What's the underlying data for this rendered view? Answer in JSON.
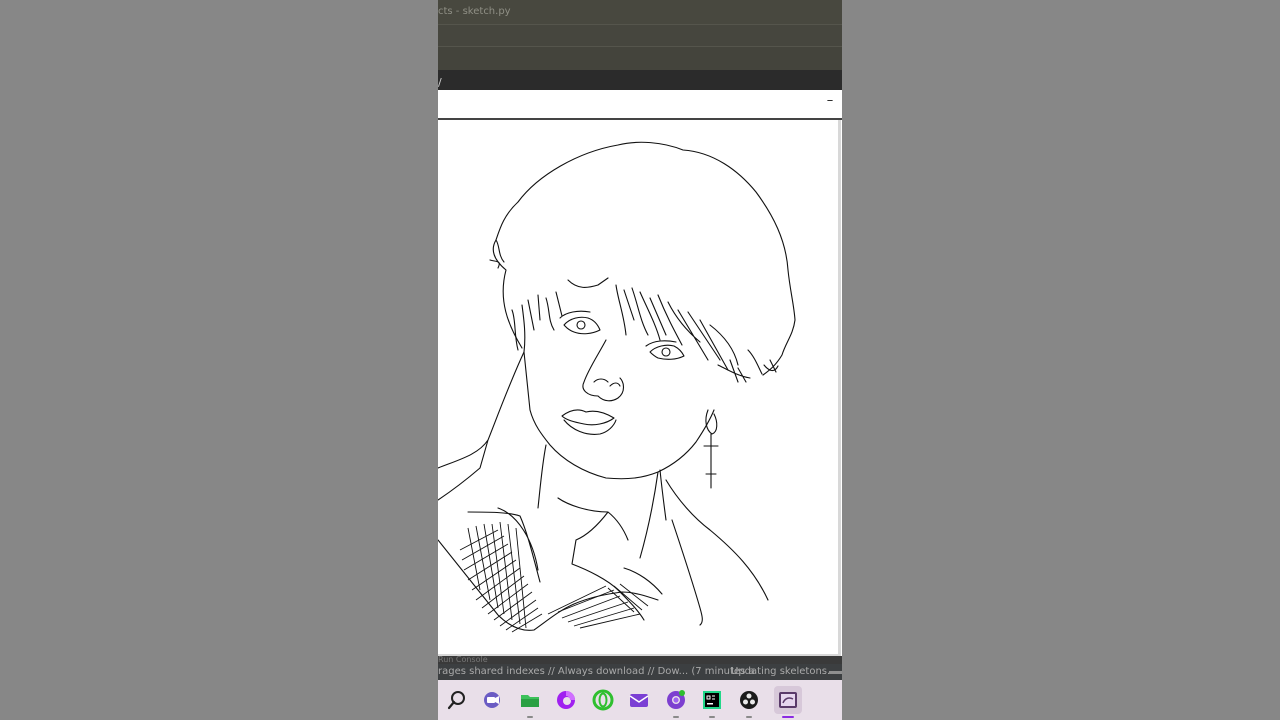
{
  "ide": {
    "window_title": "cts - sketch.py",
    "tab_glyph": "/"
  },
  "sketch_window": {
    "minimize_glyph": "–"
  },
  "console": {
    "label": "Run Console"
  },
  "status_bar": {
    "left_text": "rages shared indexes // Always download // Dow... (7 minutes a",
    "right_text": "Updating skeletons..."
  },
  "taskbar": {
    "apps": [
      {
        "name": "search-icon"
      },
      {
        "name": "video-call-icon"
      },
      {
        "name": "file-explorer-icon"
      },
      {
        "name": "edge-browser-icon"
      },
      {
        "name": "opera-browser-icon"
      },
      {
        "name": "mail-icon"
      },
      {
        "name": "chrome-browser-icon"
      },
      {
        "name": "pycharm-icon"
      },
      {
        "name": "obs-studio-icon"
      },
      {
        "name": "sketch-app-icon"
      }
    ]
  },
  "colors": {
    "desktop": "#878787",
    "taskbar": "#e9dfe9",
    "accent": "#8b2be2"
  }
}
